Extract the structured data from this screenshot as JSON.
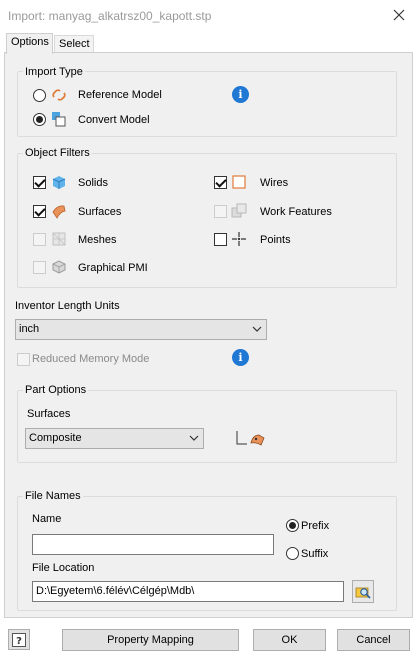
{
  "window": {
    "title": "Import:  manyag_alkatrsz00_kapott.stp"
  },
  "tabs": [
    {
      "label": "Options"
    },
    {
      "label": "Select"
    }
  ],
  "import_type": {
    "title": "Import Type",
    "reference_model": "Reference Model",
    "convert_model": "Convert Model",
    "selected": "Convert Model"
  },
  "object_filters": {
    "title": "Object Filters",
    "solids": "Solids",
    "surfaces": "Surfaces",
    "meshes": "Meshes",
    "graphical_pmi": "Graphical PMI",
    "wires": "Wires",
    "work_features": "Work Features",
    "points": "Points"
  },
  "length_units": {
    "label": "Inventor Length Units",
    "value": "inch"
  },
  "reduced_memory": {
    "label": "Reduced Memory Mode"
  },
  "part_options": {
    "title": "Part Options",
    "surfaces_label": "Surfaces",
    "surfaces_value": "Composite"
  },
  "file_names": {
    "title": "File Names",
    "name_label": "Name",
    "name_value": "",
    "prefix": "Prefix",
    "suffix": "Suffix",
    "location_label": "File Location",
    "location_value": "D:\\Egyetem\\6.félév\\Célgép\\Mdb\\"
  },
  "footer": {
    "property_mapping": "Property Mapping",
    "ok": "OK",
    "cancel": "Cancel"
  }
}
